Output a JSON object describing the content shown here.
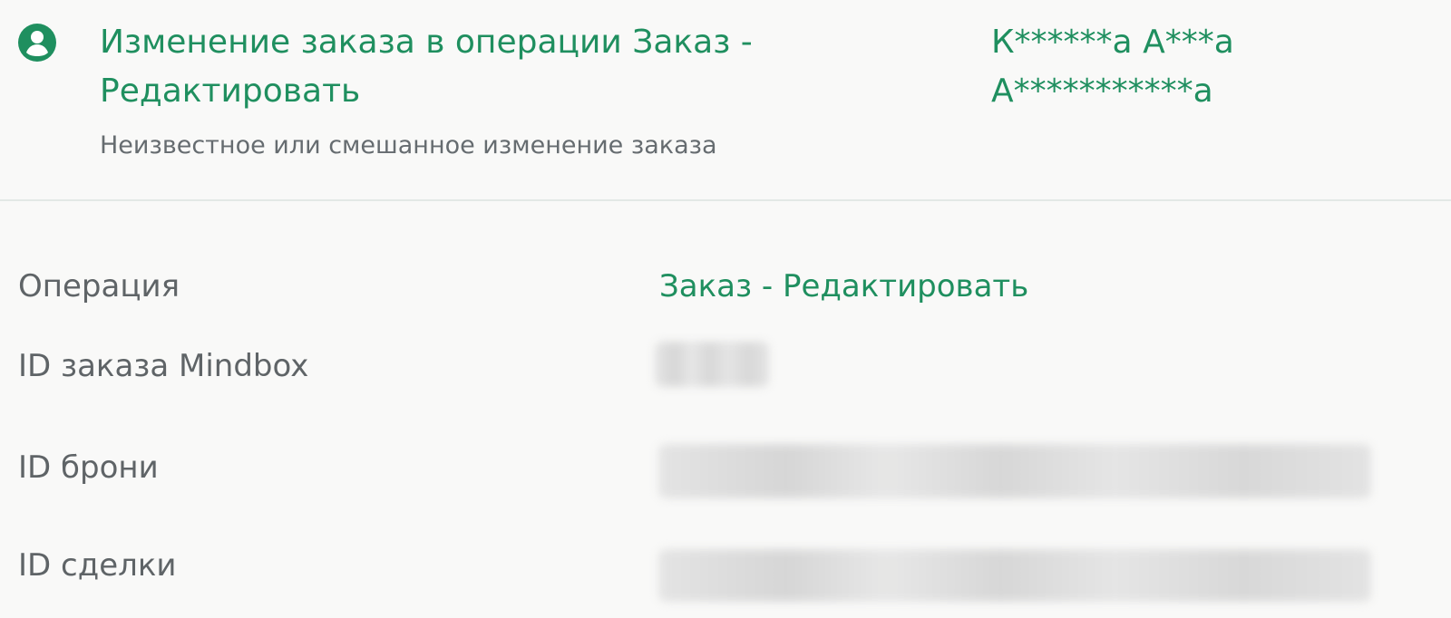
{
  "header": {
    "title": "Изменение заказа в операции Заказ - Редактировать",
    "subtitle": "Неизвестное или смешанное изменение заказа",
    "user_name": "К******а А***а А***********а",
    "icon": "user-circle-icon",
    "accent_color": "#1f8f5f"
  },
  "details": {
    "operation_label": "Операция",
    "operation_value": "Заказ - Редактировать",
    "mindbox_id_label": "ID заказа Mindbox",
    "booking_id_label": "ID брони",
    "deal_id_label": "ID сделки"
  }
}
